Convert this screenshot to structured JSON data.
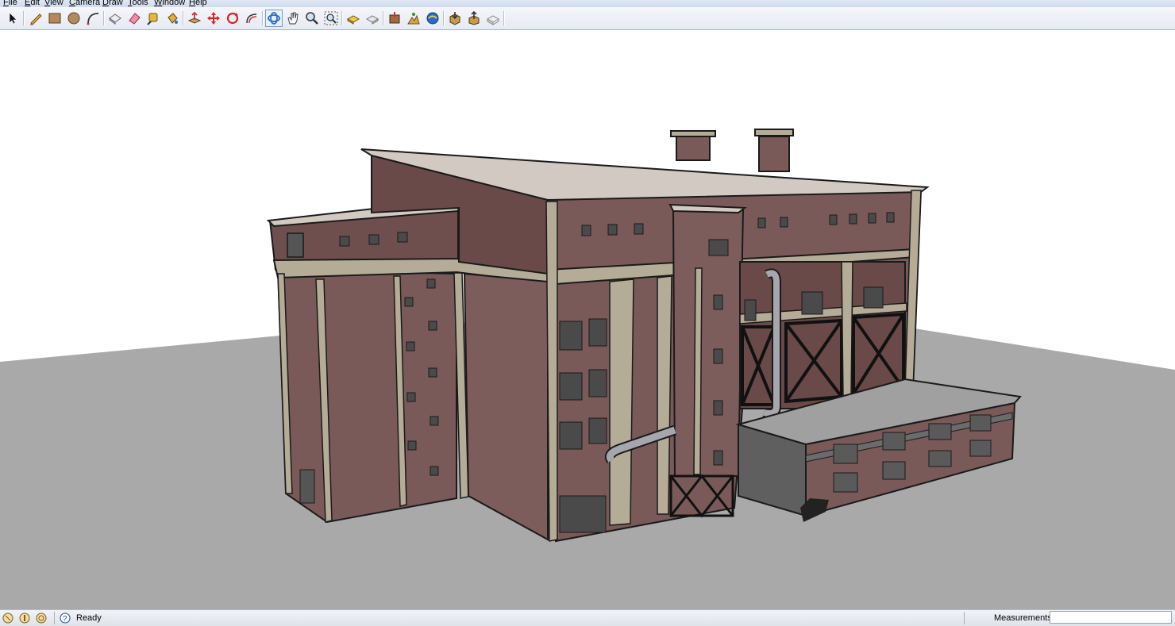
{
  "menubar": {
    "items": [
      "File",
      "Edit",
      "View",
      "Camera",
      "Draw",
      "Tools",
      "Window",
      "Help"
    ]
  },
  "toolbar": {
    "tools": [
      {
        "name": "select-tool-icon",
        "label": "Select"
      },
      {
        "name": "pencil-tool-icon",
        "label": "Line"
      },
      {
        "name": "rectangle-tool-icon",
        "label": "Rectangle"
      },
      {
        "name": "circle-tool-icon",
        "label": "Circle"
      },
      {
        "name": "arc-tool-icon",
        "label": "Arc"
      },
      {
        "name": "make-component-icon",
        "label": "Make Component"
      },
      {
        "name": "eraser-tool-icon",
        "label": "Eraser"
      },
      {
        "name": "tape-measure-icon",
        "label": "Tape Measure"
      },
      {
        "name": "paint-bucket-icon",
        "label": "Paint Bucket"
      },
      {
        "name": "push-pull-icon",
        "label": "Push/Pull"
      },
      {
        "name": "move-tool-icon",
        "label": "Move"
      },
      {
        "name": "rotate-tool-icon",
        "label": "Rotate"
      },
      {
        "name": "offset-tool-icon",
        "label": "Offset"
      },
      {
        "name": "orbit-tool-icon",
        "label": "Orbit"
      },
      {
        "name": "pan-tool-icon",
        "label": "Pan"
      },
      {
        "name": "zoom-tool-icon",
        "label": "Zoom"
      },
      {
        "name": "zoom-extents-icon",
        "label": "Zoom Extents"
      },
      {
        "name": "previous-view-icon",
        "label": "Previous"
      },
      {
        "name": "next-view-icon",
        "label": "Next"
      },
      {
        "name": "add-location-icon",
        "label": "Add Location"
      },
      {
        "name": "toggle-terrain-icon",
        "label": "Toggle Terrain"
      },
      {
        "name": "photo-textures-icon",
        "label": "Photo Textures"
      },
      {
        "name": "get-models-icon",
        "label": "Get Models"
      },
      {
        "name": "share-model-icon",
        "label": "Share Model"
      },
      {
        "name": "extension-warehouse-icon",
        "label": "Extension Warehouse"
      }
    ]
  },
  "viewport": {
    "sky_color": "#ffffff",
    "ground_color": "#a9a9a9",
    "brick_color": "#7a5a58",
    "trim_color": "#b4ac96",
    "roof_color": "#d2cac2"
  },
  "statusbar": {
    "icons": [
      "geo-location-icon",
      "credits-icon",
      "user-account-icon",
      "help-icon"
    ],
    "status_text": "Ready",
    "measurements_label": "Measurements",
    "measurements_value": ""
  }
}
